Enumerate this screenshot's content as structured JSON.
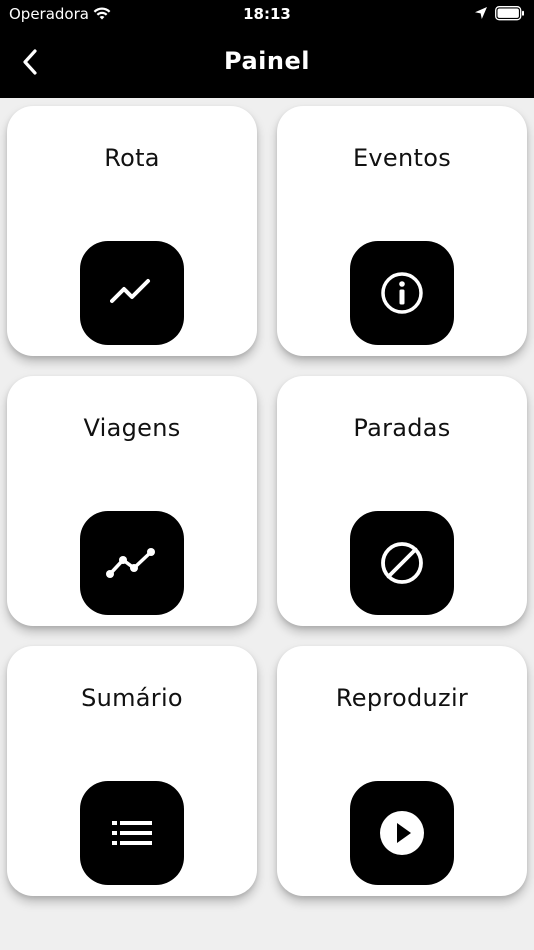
{
  "status_bar": {
    "carrier": "Operadora",
    "time": "18:13",
    "icons": [
      "wifi-icon",
      "location-arrow-icon",
      "battery-icon"
    ]
  },
  "header": {
    "title": "Painel",
    "back_icon": "chevron-left-icon",
    "background": "#000000"
  },
  "cards": [
    {
      "label": "Rota",
      "icon": "trending-line-icon"
    },
    {
      "label": "Eventos",
      "icon": "info-circle-icon"
    },
    {
      "label": "Viagens",
      "icon": "timeline-points-icon"
    },
    {
      "label": "Paradas",
      "icon": "block-icon"
    },
    {
      "label": "Sumário",
      "icon": "list-icon"
    },
    {
      "label": "Reproduzir",
      "icon": "play-circle-icon"
    }
  ]
}
